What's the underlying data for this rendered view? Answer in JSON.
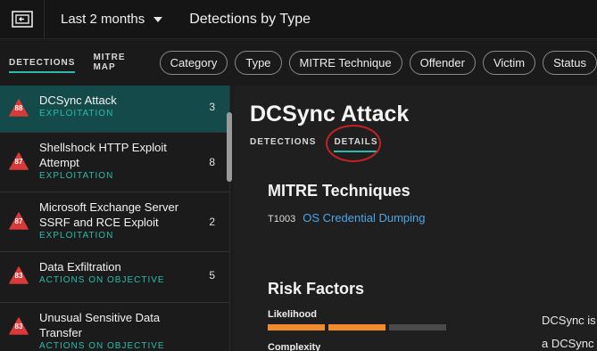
{
  "topbar": {
    "time_range": "Last 2 months",
    "view_title": "Detections by Type"
  },
  "mode_tabs": [
    {
      "label": "DETECTIONS",
      "active": true
    },
    {
      "label": "MITRE MAP",
      "active": false
    }
  ],
  "filters": [
    "Category",
    "Type",
    "MITRE Technique",
    "Offender",
    "Victim",
    "Status"
  ],
  "detections": [
    {
      "score": "88",
      "name": "DCSync Attack",
      "category": "EXPLOITATION",
      "count": "3",
      "selected": true
    },
    {
      "score": "87",
      "name": "Shellshock HTTP Exploit Attempt",
      "category": "EXPLOITATION",
      "count": "8",
      "selected": false
    },
    {
      "score": "87",
      "name": "Microsoft Exchange Server SSRF and RCE Exploit",
      "category": "EXPLOITATION",
      "count": "2",
      "selected": false
    },
    {
      "score": "83",
      "name": "Data Exfiltration",
      "category": "ACTIONS ON OBJECTIVE",
      "count": "5",
      "selected": false
    },
    {
      "score": "83",
      "name": "Unusual Sensitive Data Transfer",
      "category": "ACTIONS ON OBJECTIVE",
      "count": "",
      "selected": false
    }
  ],
  "detail": {
    "title": "DCSync Attack",
    "tabs": [
      {
        "label": "DETECTIONS",
        "active": false
      },
      {
        "label": "DETAILS",
        "active": true
      }
    ],
    "mitre_heading": "MITRE Techniques",
    "technique_id": "T1003",
    "technique_name": "OS Credential Dumping",
    "risk_heading": "Risk Factors",
    "likelihood_label": "Likelihood",
    "likelihood_level": 2,
    "likelihood_max": 3,
    "complexity_label": "Complexity",
    "description_line1": "DCSync is a",
    "description_line2": "a DCSync a"
  },
  "colors": {
    "accent": "#2bbcae",
    "selected_bg": "#144a49",
    "badge_red": "#d83a3a",
    "bar_fill": "#f08a2e",
    "bar_empty": "#4a4a4a",
    "link": "#4ea5e8",
    "annotation_ring": "#c42222"
  }
}
